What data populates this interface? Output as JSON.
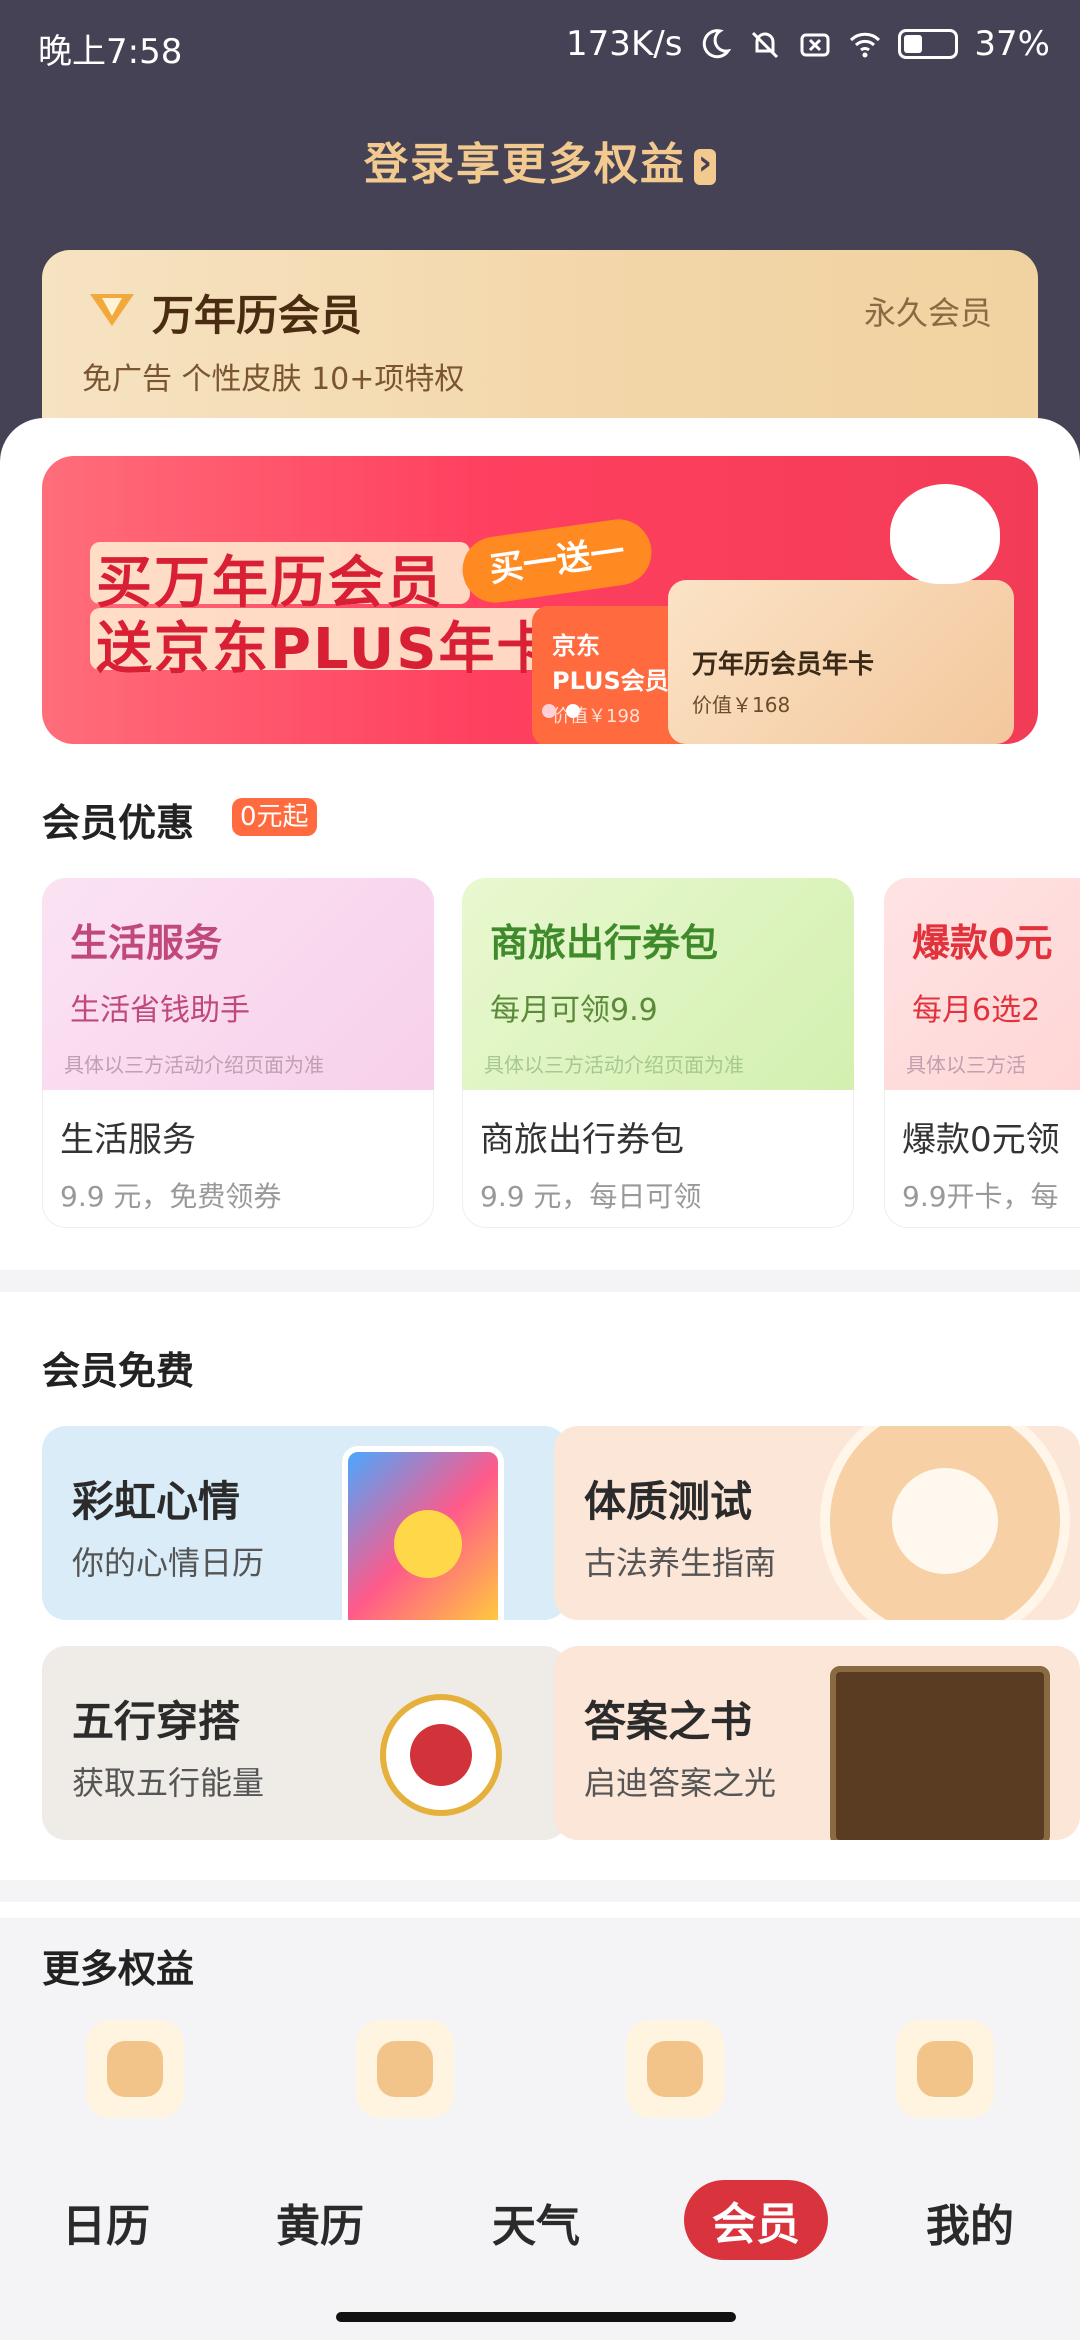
{
  "status": {
    "time": "晚上7:58",
    "speed": "173K/s",
    "battery": "37%"
  },
  "top": {
    "login": "登录享更多权益"
  },
  "member_card": {
    "title": "万年历会员",
    "perm": "永久会员",
    "desc": "免广告  个性皮肤  10+项特权"
  },
  "banner": {
    "line1": "买万年历会员",
    "line2": "送京东PLUS年卡",
    "bogo": "买一送一",
    "card1": "京东\nPLUS会员",
    "card1_price": "价值￥198",
    "card2_title": "万年历会员年卡",
    "card2_price": "价值￥168"
  },
  "discounts": {
    "title": "会员优惠",
    "badge": "0元起",
    "items": [
      {
        "img_title": "生活服务",
        "img_sub": "生活省钱助手",
        "note": "具体以三方活动介绍页面为准",
        "name": "生活服务",
        "sub": "9.9 元，免费领券"
      },
      {
        "img_title": "商旅出行券包",
        "img_sub": "每月可领9.9",
        "note": "具体以三方活动介绍页面为准",
        "name": "商旅出行券包",
        "sub": "9.9 元，每日可领"
      },
      {
        "img_title": "爆款0元",
        "img_sub": "每月6选2",
        "note": "具体以三方活",
        "name": "爆款0元领",
        "sub": "9.9开卡，每"
      }
    ]
  },
  "free": {
    "title": "会员免费",
    "items": [
      {
        "title": "彩虹心情",
        "sub": "你的心情日历"
      },
      {
        "title": "体质测试",
        "sub": "古法养生指南"
      },
      {
        "title": "五行穿搭",
        "sub": "获取五行能量"
      },
      {
        "title": "答案之书",
        "sub": "启迪答案之光"
      }
    ]
  },
  "more": {
    "title": "更多权益"
  },
  "tabs": [
    "日历",
    "黄历",
    "天气",
    "会员",
    "我的"
  ],
  "colors": {
    "header": "#464255",
    "accent": "#d9333d",
    "gold": "#f2c98f"
  }
}
